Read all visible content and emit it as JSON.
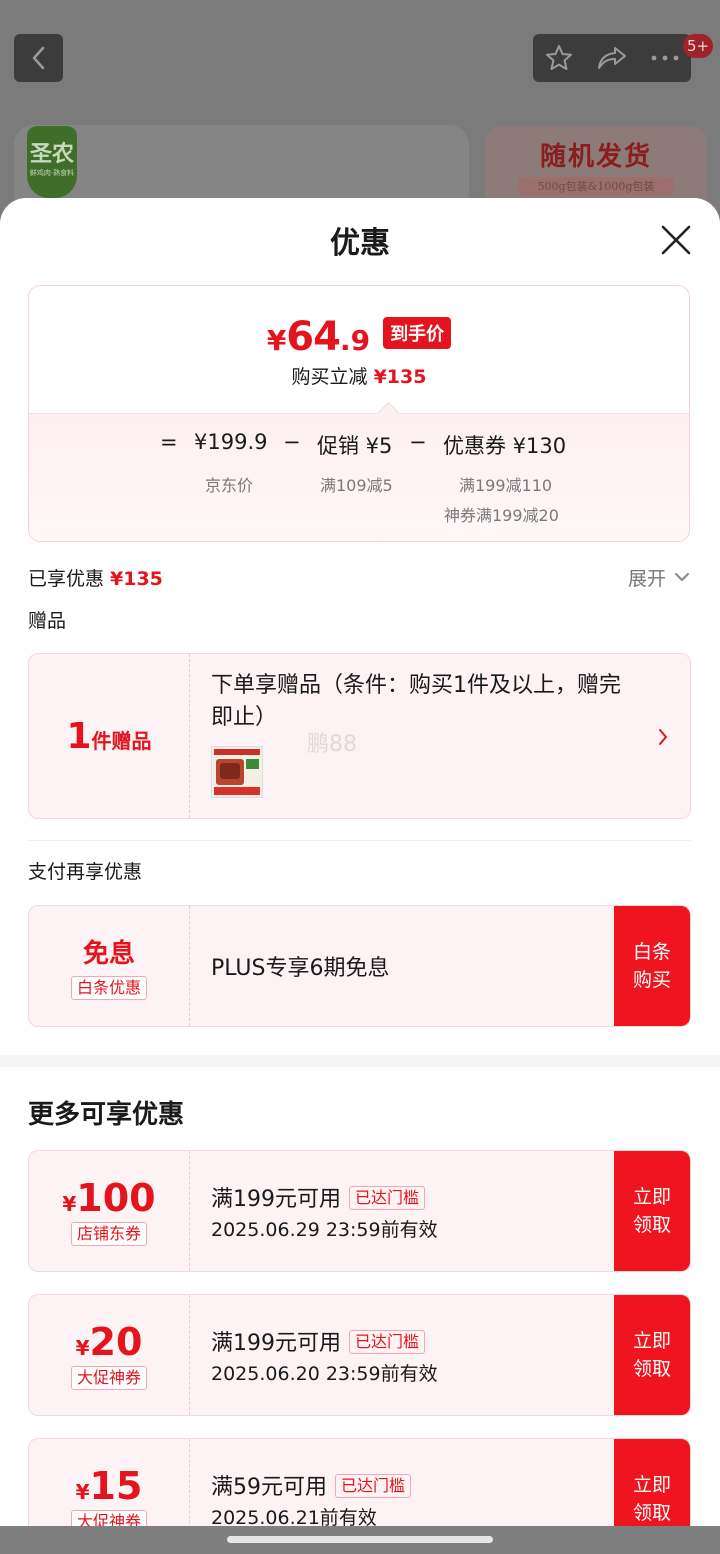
{
  "background": {
    "message_badge": "5+",
    "brand_logo_text": "圣农",
    "brand_logo_subtext": "鲜鸡肉·熟食料",
    "promo_title": "随机发货",
    "promo_subtitle": "500g包装&1000g包装"
  },
  "sheet": {
    "title": "优惠",
    "summary": {
      "yen": "¥",
      "price_int": "64",
      "price_dec": ".9",
      "price_tag": "到手价",
      "reduce_label": "购买立减",
      "reduce_amount": "¥135",
      "formula": {
        "eq": "=",
        "jd_price": "¥199.9",
        "jd_price_label": "京东价",
        "minus1": "−",
        "promo": "促销 ¥5",
        "promo_label": "满109减5",
        "minus2": "−",
        "coupon": "优惠券 ¥130",
        "coupon_label_1": "满199减110",
        "coupon_label_2": "神券满199减20"
      }
    },
    "enjoyed_label": "已享优惠",
    "enjoyed_amount": "¥135",
    "expand_label": "展开",
    "gift_section_label": "赠品",
    "gift_card": {
      "count": "1",
      "count_unit": "件赠品",
      "desc": "下单享赠品（条件：购买1件及以上，赠完即止）"
    },
    "watermark": "鹏88",
    "pay_section_label": "支付再享优惠",
    "pay_card": {
      "title": "免息",
      "tag": "白条优惠",
      "desc": "PLUS专享6期免息",
      "action_line1": "白条",
      "action_line2": "购买"
    },
    "more_title": "更多可享优惠",
    "coupons": [
      {
        "yen": "¥",
        "value": "100",
        "tag": "店铺东券",
        "condition": "满199元可用",
        "status": "已达门槛",
        "validity": "2025.06.29 23:59前有效",
        "action_line1": "立即",
        "action_line2": "领取"
      },
      {
        "yen": "¥",
        "value": "20",
        "tag": "大促神券",
        "condition": "满199元可用",
        "status": "已达门槛",
        "validity": "2025.06.20 23:59前有效",
        "action_line1": "立即",
        "action_line2": "领取"
      },
      {
        "yen": "¥",
        "value": "15",
        "tag": "大促神券",
        "condition": "满59元可用",
        "status": "已达门槛",
        "validity": "2025.06.21前有效",
        "action_line1": "立即",
        "action_line2": "领取"
      }
    ]
  },
  "colors": {
    "accent_red": "#e4141f",
    "button_red": "#f0141e",
    "card_bg": "#fdf3f4"
  }
}
